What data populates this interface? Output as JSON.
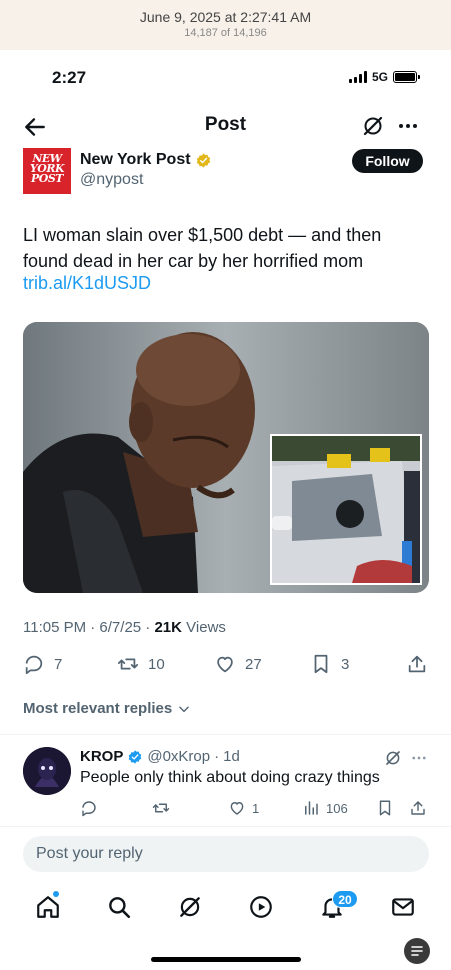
{
  "photo_header": {
    "date": "June 9, 2025 at 2:27:41 AM",
    "count": "14,187 of 14,196"
  },
  "status_bar": {
    "time": "2:27",
    "network": "5G"
  },
  "nav": {
    "title": "Post"
  },
  "author": {
    "logo_text": "NEW YORK POST",
    "name": "New York Post",
    "handle": "@nypost",
    "follow_label": "Follow"
  },
  "post": {
    "text": "LI woman slain over $1,500 debt — and then found dead in her car by her horrified mom",
    "link": "trib.al/K1dUSJD",
    "time": "11:05 PM · 6/7/25 · ",
    "views_count": "21K",
    "views_label": " Views"
  },
  "stats": {
    "replies": "7",
    "reposts": "10",
    "likes": "27",
    "bookmarks": "3"
  },
  "sort_label": "Most relevant replies",
  "reply": {
    "name": "KROP",
    "handle": "@0xKrop",
    "sep": "·",
    "time": "1d",
    "text": "People only think about doing crazy things",
    "replies": "",
    "reposts": "",
    "likes": "1",
    "views": "106"
  },
  "reply_box": {
    "placeholder": "Post your reply"
  },
  "tabbar": {
    "notifications_badge": "20"
  },
  "colors": {
    "accent": "#1d9bf0",
    "brand_red": "#d8232a",
    "text": "#0f1419",
    "muted": "#536471"
  }
}
